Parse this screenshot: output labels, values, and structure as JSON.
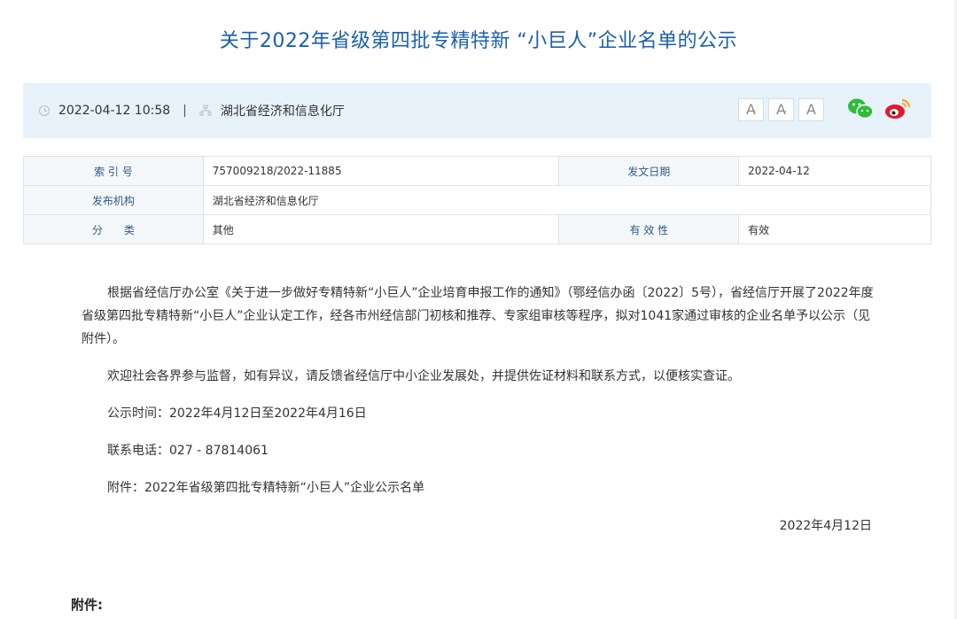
{
  "article": {
    "title": "关于2022年省级第四批专精特新 “小巨人”企业名单的公示"
  },
  "meta": {
    "datetime": "2022-04-12 10:58",
    "separator": "|",
    "publisher": "湖北省经济和信息化厅",
    "font_buttons": [
      "A",
      "A",
      "A"
    ],
    "font_button_marks": [
      "+",
      "-"
    ],
    "share_icons": [
      "wechat-icon",
      "weibo-icon"
    ]
  },
  "info_table": {
    "index_label": "索 引 号",
    "index_value": "757009218/2022-11885",
    "date_label": "发文日期",
    "date_value": "2022-04-12",
    "org_label": "发布机构",
    "org_value": "湖北省经济和信息化厅",
    "category_label": "分　　类",
    "category_value": "其他",
    "validity_label": "有 效 性",
    "validity_value": "有效"
  },
  "body": {
    "p1": "根据省经信厅办公室《关于进一步做好专精特新“小巨人”企业培育申报工作的通知》（鄂经信办函〔2022〕5号），省经信厅开展了2022年度省级第四批专精特新“小巨人”企业认定工作，经各市州经信部门初核和推荐、专家组审核等程序，拟对1041家通过审核的企业名单予以公示（见附件）。",
    "p2": "欢迎社会各界参与监督，如有异议，请反馈省经信厅中小企业发展处，并提供佐证材料和联系方式，以便核实查证。",
    "p3": "公示时间：2022年4月12日至2022年4月16日",
    "p4": "联系电话：027 - 87814061",
    "p5": "附件：2022年省级第四批专精特新“小巨人”企业公示名单",
    "sign_date": "2022年4月12日"
  },
  "attachments": {
    "heading": "附件:"
  },
  "colors": {
    "title": "#1a60b0",
    "meta_bg": "#e8f2fb",
    "wechat": "#2dbd3a",
    "weibo": "#e6162d"
  }
}
